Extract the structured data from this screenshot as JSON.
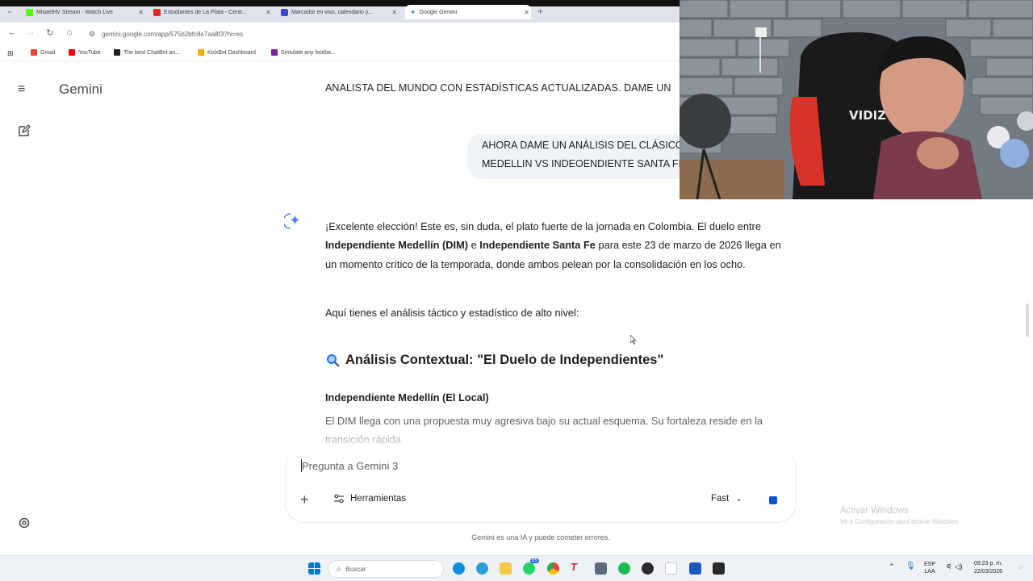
{
  "browser": {
    "tabs": [
      {
        "title": "MisaelHV Stream - Watch Live",
        "color": "#53fc18"
      },
      {
        "title": "Estudiantes de La Plata - Centr...",
        "color": "#d93025"
      },
      {
        "title": "Marcador en vivo, calendario y...",
        "color": "#3b4cca"
      },
      {
        "title": "Google Gemini",
        "color": "#4285f4"
      }
    ],
    "url": "gemini.google.com/app/575b2bfc8e7aa8f3?hl=es",
    "bookmarks": [
      {
        "label": "Gmail",
        "color": "#ea4335"
      },
      {
        "label": "YouTube",
        "color": "#ff0000"
      },
      {
        "label": "The best ChatBot an...",
        "color": "#202124"
      },
      {
        "label": "KickBot Dashboard",
        "color": "#f9ab00"
      },
      {
        "label": "Simulate any footba...",
        "color": "#7b1fa2"
      }
    ]
  },
  "gemini": {
    "title": "Gemini",
    "previous_prompt": "ANALISTA DEL MUNDO CON ESTADÍSTICAS ACTUALIZADAS. DAME UN",
    "user_message": {
      "line1": "AHORA DAME UN ANÁLISIS DEL CLÁSICO",
      "line2": "MEDELLIN VS INDEOENDIENTE SANTA FE"
    },
    "response": {
      "p1_a": "¡Excelente elección! Este es, sin duda, el plato fuerte de la jornada en Colombia. El duelo entre ",
      "p1_b": "Independiente Medellín (DIM)",
      "p1_c": " e ",
      "p1_d": "Independiente Santa Fe",
      "p1_e": " para este 23 de marzo de 2026 llega en un momento crítico de la temporada, donde ambos pelean por la consolidación en los ocho.",
      "p2": "Aquí tienes el análisis táctico y estadístico de alto nivel:",
      "heading": "Análisis Contextual: \"El Duelo de Independientes\"",
      "subheading": "Independiente Medellín (El Local)",
      "p3": "El DIM llega con una propuesta muy agresiva bajo su actual esquema. Su fortaleza reside en la transición rápida"
    },
    "input": {
      "placeholder": "Pregunta a Gemini 3",
      "tools_label": "Herramientas",
      "model_label": "Fast"
    },
    "disclaimer": "Gemini es una IA y puede cometer errores."
  },
  "windows": {
    "activate_title": "Activar Windows",
    "activate_sub": "Ve a Configuración para activar Windows.",
    "search_placeholder": "Buscar",
    "lang_top": "ESP",
    "lang_bottom": "LAA",
    "time": "09:23 p. m.",
    "date": "22/03/2026",
    "badge_count": "65"
  },
  "webcam": {
    "chair_text": "VIDIZ"
  }
}
